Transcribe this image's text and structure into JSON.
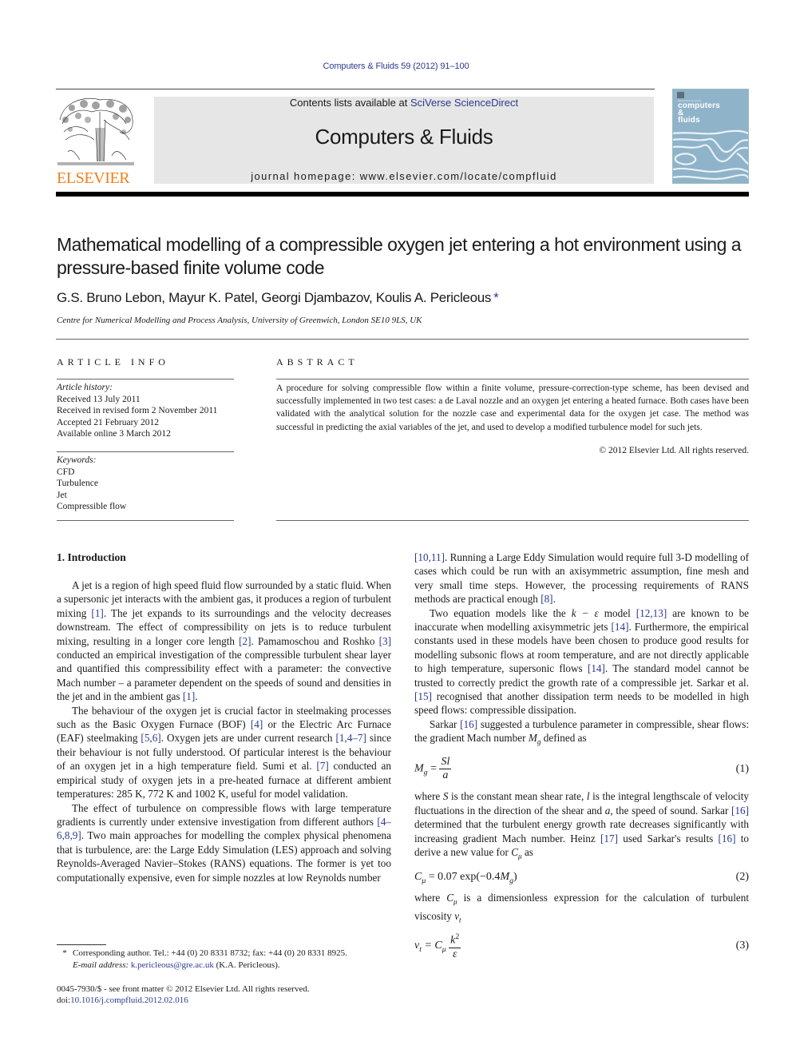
{
  "header": {
    "running_head": "Computers & Fluids 59 (2012) 91–100",
    "contents_prefix": "Contents lists available at ",
    "contents_link": "SciVerse ScienceDirect",
    "journal_title": "Computers & Fluids",
    "homepage_prefix": "journal homepage: ",
    "homepage_url": "www.elsevier.com/locate/compfluid",
    "publisher_wordmark": "ELSEVIER",
    "cover": {
      "small": "An International Journal",
      "line1": "computers",
      "line2": "&",
      "line3": "fluids"
    },
    "colors": {
      "link": "#2b3990",
      "elsevier_orange": "#f07f1a",
      "masthead_bg": "#e6e6e6",
      "cover_bg": "#8fb3c9"
    }
  },
  "article": {
    "title": "Mathematical modelling of a compressible oxygen jet entering a hot environment using a pressure-based finite volume code",
    "authors": "G.S. Bruno Lebon, Mayur K. Patel, Georgi Djambazov, Koulis A. Pericleous",
    "corresponding_marker": "*",
    "affiliation": "Centre for Numerical Modelling and Process Analysis, University of Greenwich, London SE10 9LS, UK"
  },
  "article_info": {
    "label": "ARTICLE INFO",
    "history_heading": "Article history:",
    "history": [
      "Received 13 July 2011",
      "Received in revised form 2 November 2011",
      "Accepted 21 February 2012",
      "Available online 3 March 2012"
    ],
    "keywords_heading": "Keywords:",
    "keywords": [
      "CFD",
      "Turbulence",
      "Jet",
      "Compressible flow"
    ]
  },
  "abstract": {
    "label": "ABSTRACT",
    "text": "A procedure for solving compressible flow within a finite volume, pressure-correction-type scheme, has been devised and successfully implemented in two test cases: a de Laval nozzle and an oxygen jet entering a heated furnace. Both cases have been validated with the analytical solution for the nozzle case and experimental data for the oxygen jet case. The method was successful in predicting the axial variables of the jet, and used to develop a modified turbulence model for such jets.",
    "copyright": "© 2012 Elsevier Ltd. All rights reserved."
  },
  "body": {
    "section_heading": "1. Introduction",
    "left": {
      "p1": [
        "A jet is a region of high speed fluid flow surrounded by a static fluid. When a supersonic jet interacts with the ambient gas, it produces a region of turbulent mixing ",
        "[1]",
        ". The jet expands to its surroundings and the velocity decreases downstream. The effect of compressibility on jets is to reduce turbulent mixing, resulting in a longer core length ",
        "[2]",
        ". Pamamoschou and Roshko ",
        "[3]",
        " conducted an empirical investigation of the compressible turbulent shear layer and quantified this compressibility effect with a parameter: the convective Mach number – a parameter dependent on the speeds of sound and densities in the jet and in the ambient gas ",
        "[1]",
        "."
      ],
      "p2": [
        "The behaviour of the oxygen jet is crucial factor in steelmaking processes such as the Basic Oxygen Furnace (BOF) ",
        "[4]",
        " or the Electric Arc Furnace (EAF) steelmaking ",
        "[5,6]",
        ". Oxygen jets are under current research ",
        "[1,4–7]",
        " since their behaviour is not fully understood. Of particular interest is the behaviour of an oxygen jet in a high temperature field. Sumi et al. ",
        "[7]",
        " conducted an empirical study of oxygen jets in a pre-heated furnace at different ambient temperatures: 285 K, 772 K and 1002 K, useful for model validation."
      ],
      "p3": [
        "The effect of turbulence on compressible flows with large temperature gradients is currently under extensive investigation from different authors ",
        "[4–6,8,9]",
        ". Two main approaches for modelling the complex physical phenomena that is turbulence, are: the Large Eddy Simulation (LES) approach and solving Reynolds-Averaged Navier–Stokes (RANS) equations. The former is yet too computationally expensive, even for simple nozzles at low Reynolds number"
      ]
    },
    "right": {
      "p1": [
        "[10,11]",
        ". Running a Large Eddy Simulation would require full 3-D modelling of cases which could be run with an axisymmetric assumption, fine mesh and very small time steps. However, the processing requirements of RANS methods are practical enough ",
        "[8]",
        "."
      ],
      "p2": [
        "Two equation models like the ",
        "k − ε",
        " model ",
        "[12,13]",
        " are known to be inaccurate when modelling axisymmetric jets ",
        "[14]",
        ". Furthermore, the empirical constants used in these models have been chosen to produce good results for modelling subsonic flows at room temperature, and are not directly applicable to high temperature, supersonic flows ",
        "[14]",
        ". The standard model cannot be trusted to correctly predict the growth rate of a compressible jet. Sarkar et al. ",
        "[15]",
        " recognised that another dissipation term needs to be modelled in high speed flows: compressible dissipation."
      ],
      "p3": [
        "Sarkar ",
        "[16]",
        " suggested a turbulence parameter in compressible, shear flows: the gradient Mach number ",
        "M",
        "g",
        " defined as"
      ],
      "eq1": {
        "lhs": "M",
        "lhs_sub": "g",
        "num": "Sl",
        "den": "a",
        "number": "(1)"
      },
      "p4": [
        "where ",
        "S",
        " is the constant mean shear rate, ",
        "l",
        " is the integral lengthscale of velocity fluctuations in the direction of the shear and ",
        "a",
        ", the speed of sound. Sarkar ",
        "[16]",
        " determined that the turbulent energy growth rate decreases significantly with increasing gradient Mach number. Heinz ",
        "[17]",
        " used Sarkar's results ",
        "[16]",
        " to derive a new value for ",
        "C",
        "μ",
        " as"
      ],
      "eq2": {
        "lhs": "C",
        "lhs_sub": "μ",
        "rhs": " = 0.07 exp(−0.4",
        "rhs_var": "M",
        "rhs_sub": "g",
        "rhs_end": ")",
        "number": "(2)"
      },
      "p5": [
        "where ",
        "C",
        "μ",
        " is a dimensionless expression for the calculation of turbulent viscosity ",
        "ν",
        "t"
      ],
      "eq3": {
        "lhs": "ν",
        "lhs_sub": "t",
        "mid": " = C",
        "mid_sub": "μ",
        "num": "k",
        "num_sup": "2",
        "den": "ε",
        "number": "(3)"
      }
    }
  },
  "footnotes": {
    "star": "*",
    "corresponding": "Corresponding author. Tel.: +44 (0) 20 8331 8732; fax: +44 (0) 20 8331 8925.",
    "email_label": "E-mail address:",
    "email": "k.pericleous@gre.ac.uk",
    "email_suffix": " (K.A. Pericleous).",
    "issn": "0045-7930/$ - see front matter © 2012 Elsevier Ltd. All rights reserved.",
    "doi_prefix": "doi:",
    "doi": "10.1016/j.compfluid.2012.02.016"
  }
}
